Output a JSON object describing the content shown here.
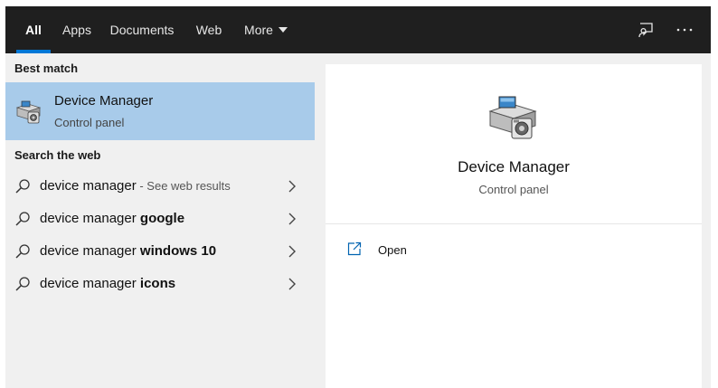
{
  "tabs": [
    {
      "label": "All",
      "active": true
    },
    {
      "label": "Apps"
    },
    {
      "label": "Documents"
    },
    {
      "label": "Web"
    },
    {
      "label": "More"
    }
  ],
  "icons": {
    "feedback": "feedback-icon",
    "more_options": "more-options-icon",
    "search": "search-icon",
    "chevron": "chevron-right-icon",
    "app": "device-manager-icon",
    "open": "open-icon"
  },
  "colors": {
    "topbar": "#1f1f1f",
    "accent": "#0078d7",
    "selected": "#a8cbea"
  },
  "best_match": {
    "section_label": "Best match",
    "title": "Device Manager",
    "subtitle": "Control panel"
  },
  "web_section": {
    "section_label": "Search the web",
    "items": [
      {
        "query": "device manager",
        "bold": "",
        "hint": " - See web results"
      },
      {
        "query": "device manager ",
        "bold": "google",
        "hint": ""
      },
      {
        "query": "device manager ",
        "bold": "windows 10",
        "hint": ""
      },
      {
        "query": "device manager ",
        "bold": "icons",
        "hint": ""
      }
    ]
  },
  "preview": {
    "title": "Device Manager",
    "subtitle": "Control panel",
    "actions": [
      {
        "label": "Open"
      }
    ]
  }
}
